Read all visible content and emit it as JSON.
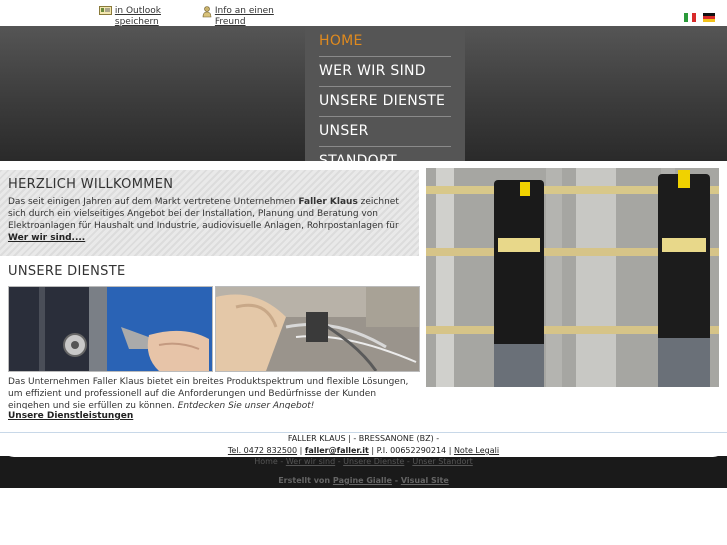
{
  "topbar": {
    "outlook_label": "in Outlook speichern",
    "friend_label": "Info an einen Freund",
    "flags": [
      "italian-flag",
      "german-flag"
    ]
  },
  "nav": {
    "items": [
      {
        "label": "HOME",
        "active": true
      },
      {
        "label": "WER WIR SIND",
        "active": false
      },
      {
        "label": "UNSERE DIENSTE",
        "active": false
      },
      {
        "label": "UNSER STANDORT",
        "active": false
      }
    ]
  },
  "welcome": {
    "title": "HERZLICH WILLKOMMEN",
    "text_pre": "Das seit einigen Jahren auf dem Markt vertretene Unternehmen ",
    "text_bold": "Faller Klaus",
    "text_post": " zeichnet sich durch ein vielseitiges Angebot bei der Installation, Planung und Beratung von Elektroanlagen für Haushalt und Industrie, audiovisuelle Anlagen, Rohrpostanlagen für den Geldtransport etc. aus.",
    "link": "Wer wir sind...."
  },
  "services": {
    "title": "UNSERE DIENSTE",
    "text": "Das Unternehmen Faller Klaus bietet ein breites Produktspektrum und flexible Lösungen, um effizient und professionell auf die Anforderungen und Bedürfnisse der Kunden eingehen und sie erfüllen zu können. ",
    "text_italic": "Entdecken Sie unser Angebot!",
    "link": "Unsere Dienstleistungen"
  },
  "footer": {
    "company": "FALLER KLAUS | - BRESSANONE (BZ) -",
    "tel": "Tel. 0472 832500",
    "email": "faller@faller.it",
    "piva": "P.I. 00652290214",
    "legal": "Note Legali",
    "links": [
      "Home",
      "Wer wir sind",
      "Unsere Dienste",
      "Unser Standort"
    ],
    "credit_prefix": "Erstellt von",
    "credit_1": "Pagine Gialle",
    "credit_2": "Visual Site"
  },
  "colors": {
    "accent": "#e08a1e",
    "header_dark": "#3a3a3a",
    "nav_bg": "#555555"
  }
}
